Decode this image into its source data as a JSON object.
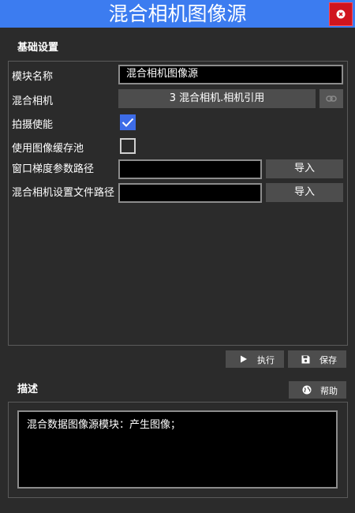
{
  "window": {
    "title": "混合相机图像源",
    "close_icon": "close-icon"
  },
  "basic_settings": {
    "section_title": "基础设置",
    "module_name": {
      "label": "模块名称",
      "value": "混合相机图像源"
    },
    "hybrid_camera": {
      "label": "混合相机",
      "value": "3 混合相机.相机引用",
      "link_icon": "link-icon"
    },
    "capture_enable": {
      "label": "拍摄使能",
      "checked": true
    },
    "use_image_pool": {
      "label": "使用图像缓存池",
      "checked": false
    },
    "window_gradient_path": {
      "label": "窗口梯度参数路径",
      "value": "",
      "import_label": "导入"
    },
    "hybrid_config_path": {
      "label": "混合相机设置文件路径",
      "value": "",
      "import_label": "导入"
    }
  },
  "actions": {
    "run_label": "执行",
    "run_icon": "play-icon",
    "save_label": "保存",
    "save_icon": "save-icon"
  },
  "description": {
    "section_title": "描述",
    "help_label": "帮助",
    "help_icon": "globe-icon",
    "text": "混合数据图像源模块：产生图像；"
  },
  "colors": {
    "background": "#2b2b2b",
    "titlebar": "#3c7cf0",
    "close": "#d0141e",
    "checkbox_checked": "#3d6ce8"
  }
}
